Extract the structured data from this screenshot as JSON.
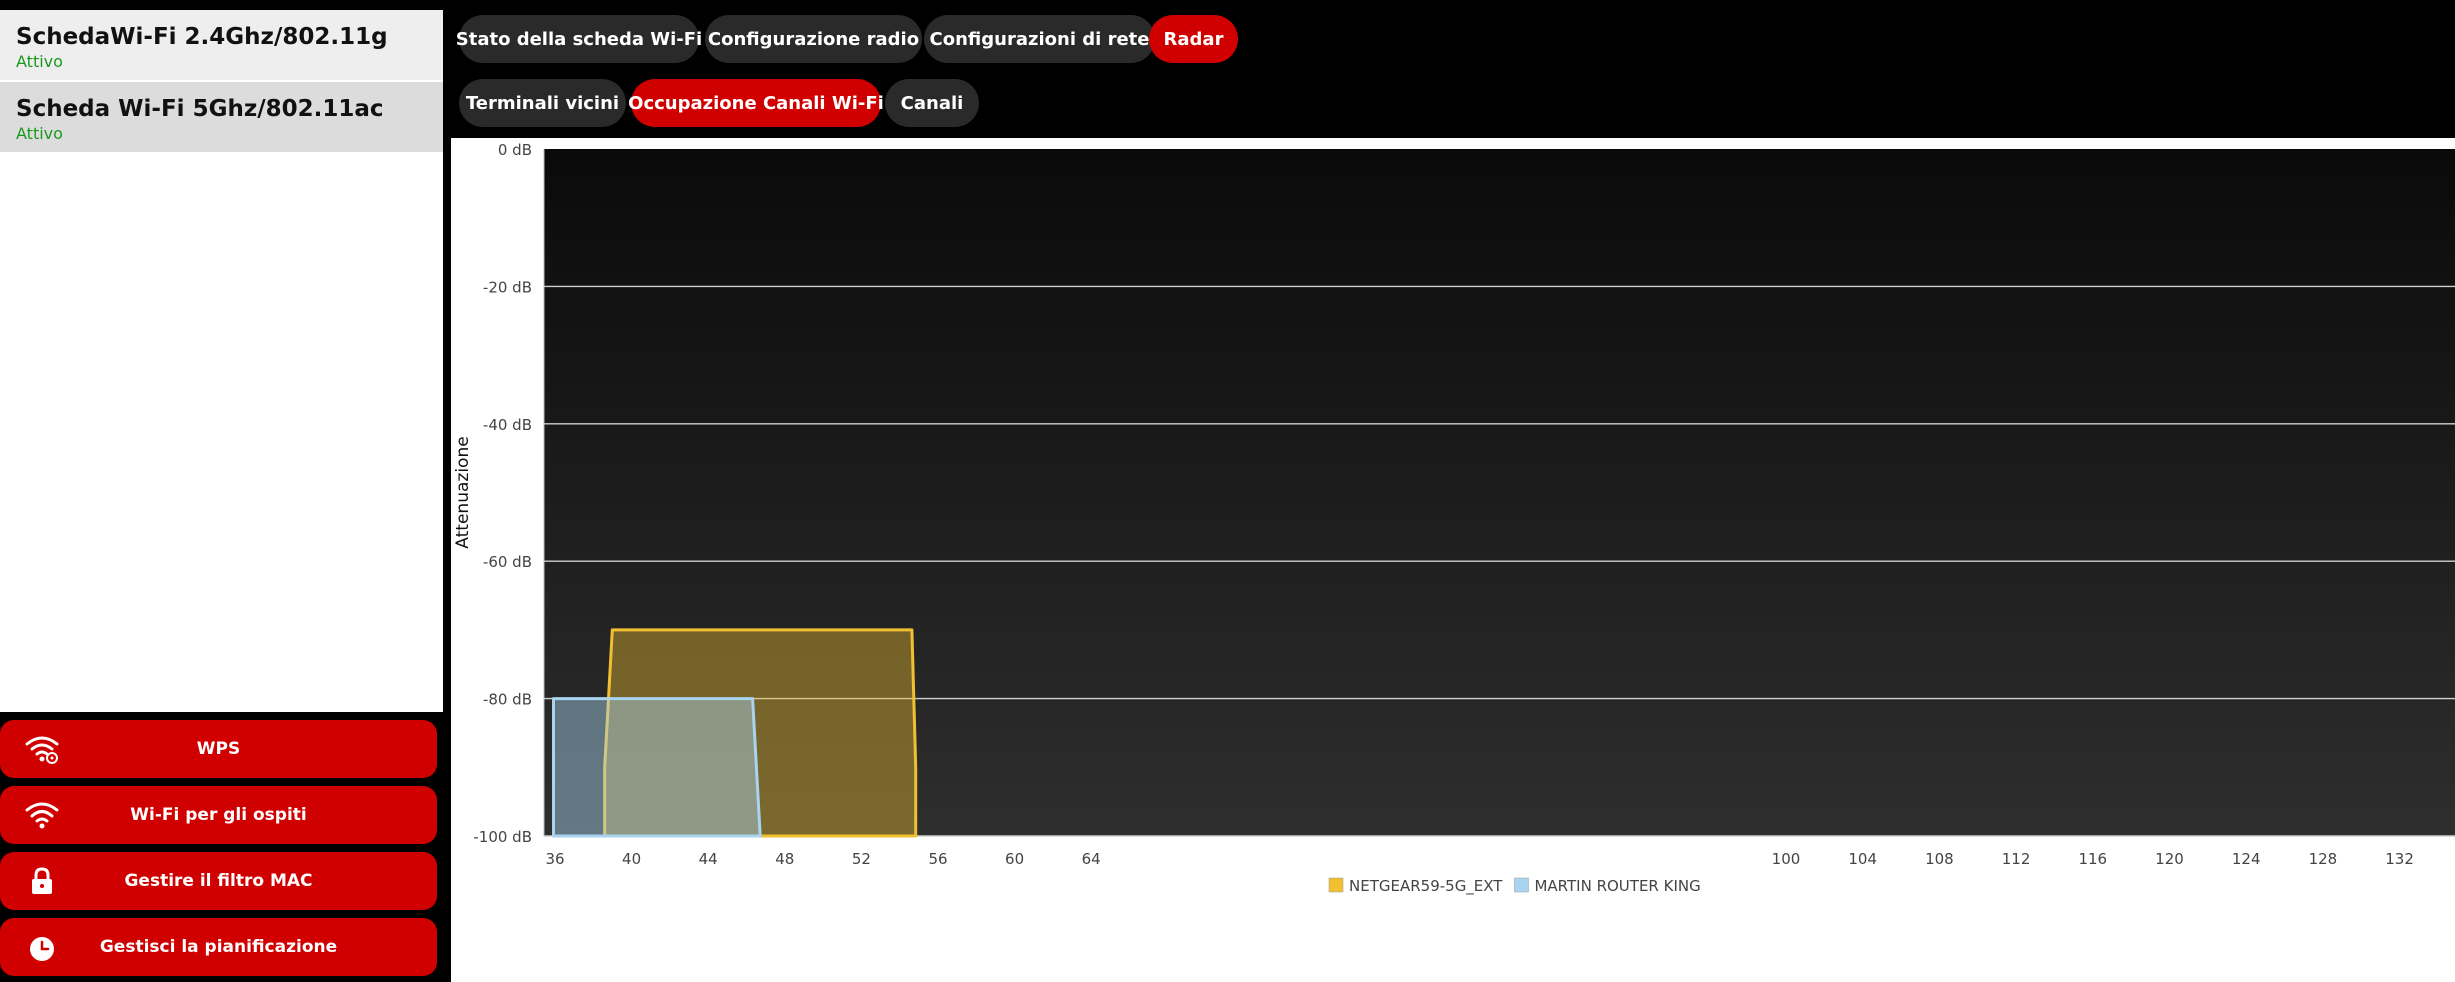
{
  "sidebar": {
    "interfaces": [
      {
        "title": "SchedaWi-Fi 2.4Ghz/802.11g",
        "status": "Attivo"
      },
      {
        "title": "Scheda Wi-Fi 5Ghz/802.11ac",
        "status": "Attivo"
      }
    ],
    "actions": [
      {
        "label": "WPS",
        "icon": "wifi-settings-icon"
      },
      {
        "label": "Wi-Fi per gli ospiti",
        "icon": "wifi-icon"
      },
      {
        "label": "Gestire il filtro MAC",
        "icon": "lock-icon"
      },
      {
        "label": "Gestisci la pianificazione",
        "icon": "clock-icon"
      }
    ]
  },
  "tabs_row1": [
    {
      "label": "Stato della scheda Wi-Fi",
      "active": false
    },
    {
      "label": "Configurazione radio",
      "active": false
    },
    {
      "label": "Configurazioni di rete",
      "active": false
    },
    {
      "label": "Radar",
      "active": true
    }
  ],
  "tabs_row2": [
    {
      "label": "Terminali vicini",
      "active": false
    },
    {
      "label": "Occupazione Canali Wi-Fi",
      "active": true
    },
    {
      "label": "Canali",
      "active": false
    }
  ],
  "colors": {
    "accent": "#d10000",
    "tab": "#2a2a2a",
    "status_ok": "#1a9a1a",
    "series_1": "#f0c030",
    "series_2": "#a8d4f0"
  },
  "chart_data": {
    "type": "area",
    "ylabel": "Attenuazione",
    "yticks": [
      "0 dB",
      "-20 dB",
      "-40 dB",
      "-60 dB",
      "-80 dB",
      "-100 dB"
    ],
    "ylim": [
      -100,
      0
    ],
    "xticks": [
      36,
      40,
      44,
      48,
      52,
      56,
      60,
      64,
      100,
      104,
      108,
      112,
      116,
      120,
      124,
      128,
      132
    ],
    "grid": true,
    "legend_position": "bottom-center",
    "series": [
      {
        "name": "NETGEAR59-5G_EXT",
        "color": "#f0c030",
        "points": [
          [
            38.2,
            -100
          ],
          [
            38.2,
            -90
          ],
          [
            38.6,
            -70
          ],
          [
            54.4,
            -70
          ],
          [
            54.6,
            -90
          ],
          [
            54.6,
            -100
          ]
        ]
      },
      {
        "name": "MARTIN ROUTER KING",
        "color": "#a8d4f0",
        "points": [
          [
            35.5,
            -100
          ],
          [
            35.5,
            -80
          ],
          [
            46.0,
            -80
          ],
          [
            46.4,
            -100
          ]
        ]
      }
    ]
  }
}
